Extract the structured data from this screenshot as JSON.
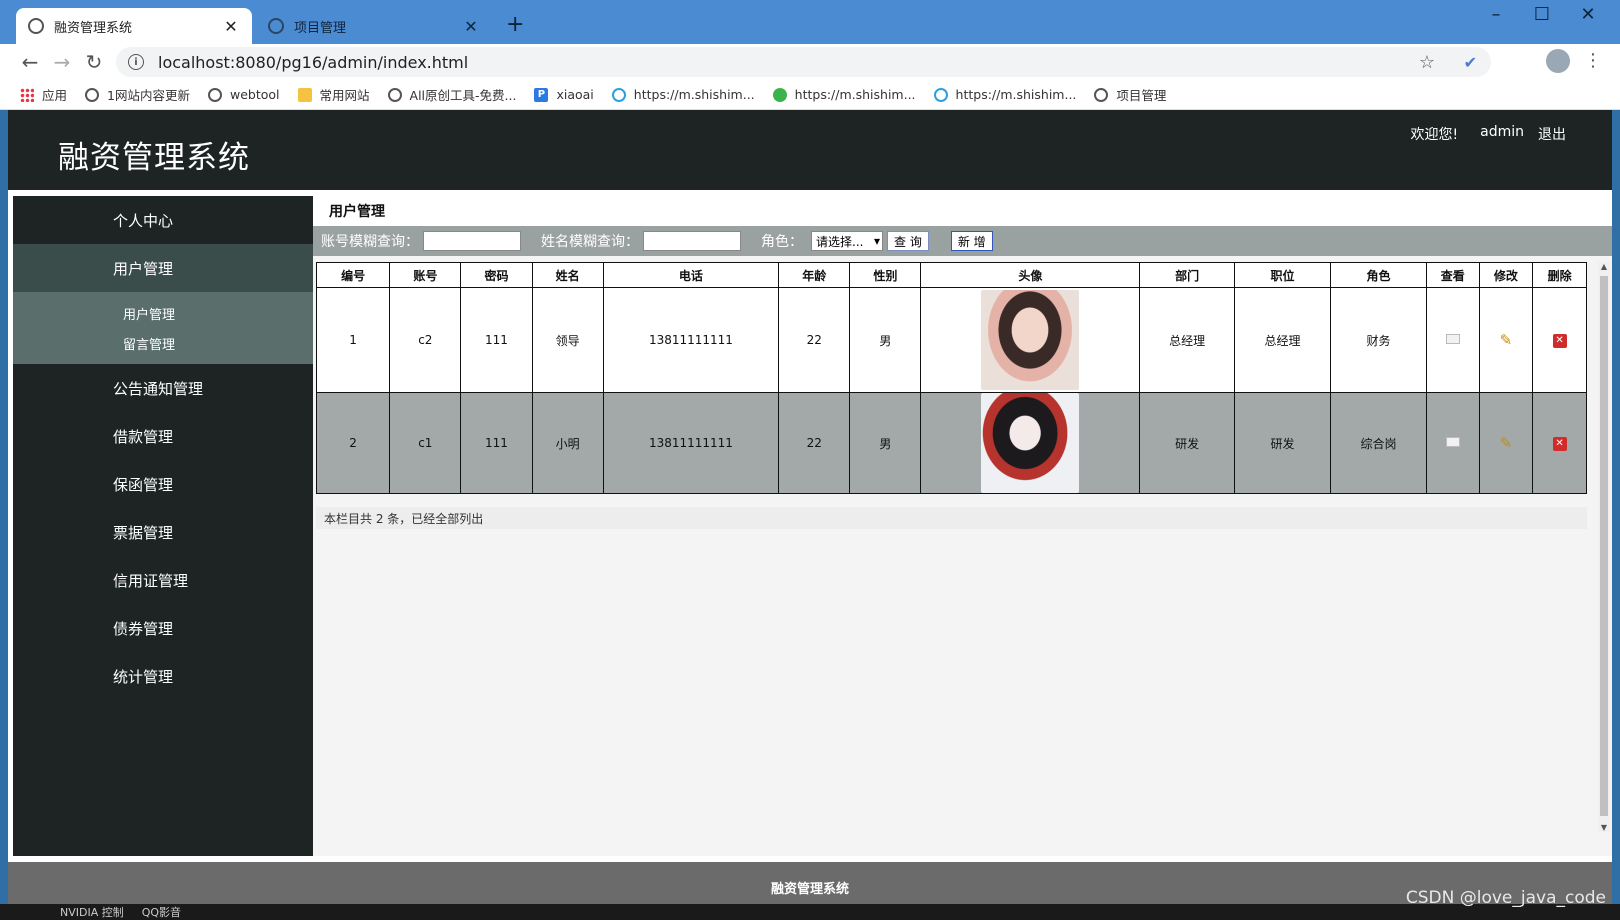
{
  "browser": {
    "tabs": [
      {
        "title": "融资管理系统",
        "active": true
      },
      {
        "title": "项目管理",
        "active": false
      }
    ],
    "new_tab": "+",
    "url": "localhost:8080/pg16/admin/index.html",
    "bookmarks": [
      {
        "label": "应用",
        "icon": "apps-icon"
      },
      {
        "label": "1网站内容更新",
        "icon": "globe-icon"
      },
      {
        "label": "webtool",
        "icon": "globe-icon"
      },
      {
        "label": "常用网站",
        "icon": "folder-icon"
      },
      {
        "label": "All原创工具-免费...",
        "icon": "globe-icon"
      },
      {
        "label": "xiaoai",
        "icon": "p-icon"
      },
      {
        "label": "https://m.shishim...",
        "icon": "c-icon"
      },
      {
        "label": "https://m.shishim...",
        "icon": "wechat-icon"
      },
      {
        "label": "https://m.shishim...",
        "icon": "c-icon"
      },
      {
        "label": "项目管理",
        "icon": "globe-icon"
      }
    ]
  },
  "header": {
    "title": "融资管理系统",
    "welcome": "欢迎您!",
    "username": "admin",
    "logout": "退出"
  },
  "sidebar": {
    "items": [
      {
        "label": "个人中心"
      },
      {
        "label": "用户管理",
        "active": true,
        "children": [
          "用户管理",
          "留言管理"
        ]
      },
      {
        "label": "公告通知管理"
      },
      {
        "label": "借款管理"
      },
      {
        "label": "保函管理"
      },
      {
        "label": "票据管理"
      },
      {
        "label": "信用证管理"
      },
      {
        "label": "债券管理"
      },
      {
        "label": "统计管理"
      }
    ]
  },
  "main": {
    "title": "用户管理",
    "search": {
      "account_label": "账号模糊查询：",
      "name_label": "姓名模糊查询：",
      "role_label": "角色：",
      "role_value": "请选择...",
      "query_button": "查 询",
      "add_button": "新 增"
    },
    "table": {
      "headers": [
        "编号",
        "账号",
        "密码",
        "姓名",
        "电话",
        "年龄",
        "性别",
        "头像",
        "部门",
        "职位",
        "角色",
        "查看",
        "修改",
        "删除"
      ],
      "rows": [
        {
          "id": "1",
          "account": "c2",
          "password": "111",
          "name": "领导",
          "phone": "13811111111",
          "age": "22",
          "gender": "男",
          "department": "总经理",
          "position": "总经理",
          "role": "财务"
        },
        {
          "id": "2",
          "account": "c1",
          "password": "111",
          "name": "小明",
          "phone": "13811111111",
          "age": "22",
          "gender": "男",
          "department": "研发",
          "position": "研发",
          "role": "综合岗"
        }
      ]
    },
    "footer_note": "本栏目共 2 条，已经全部列出"
  },
  "footer": {
    "text": "融资管理系统"
  },
  "taskbar": {
    "text": "NVIDIA 控制 　 QQ影音"
  },
  "watermark": "CSDN @love_java_code"
}
